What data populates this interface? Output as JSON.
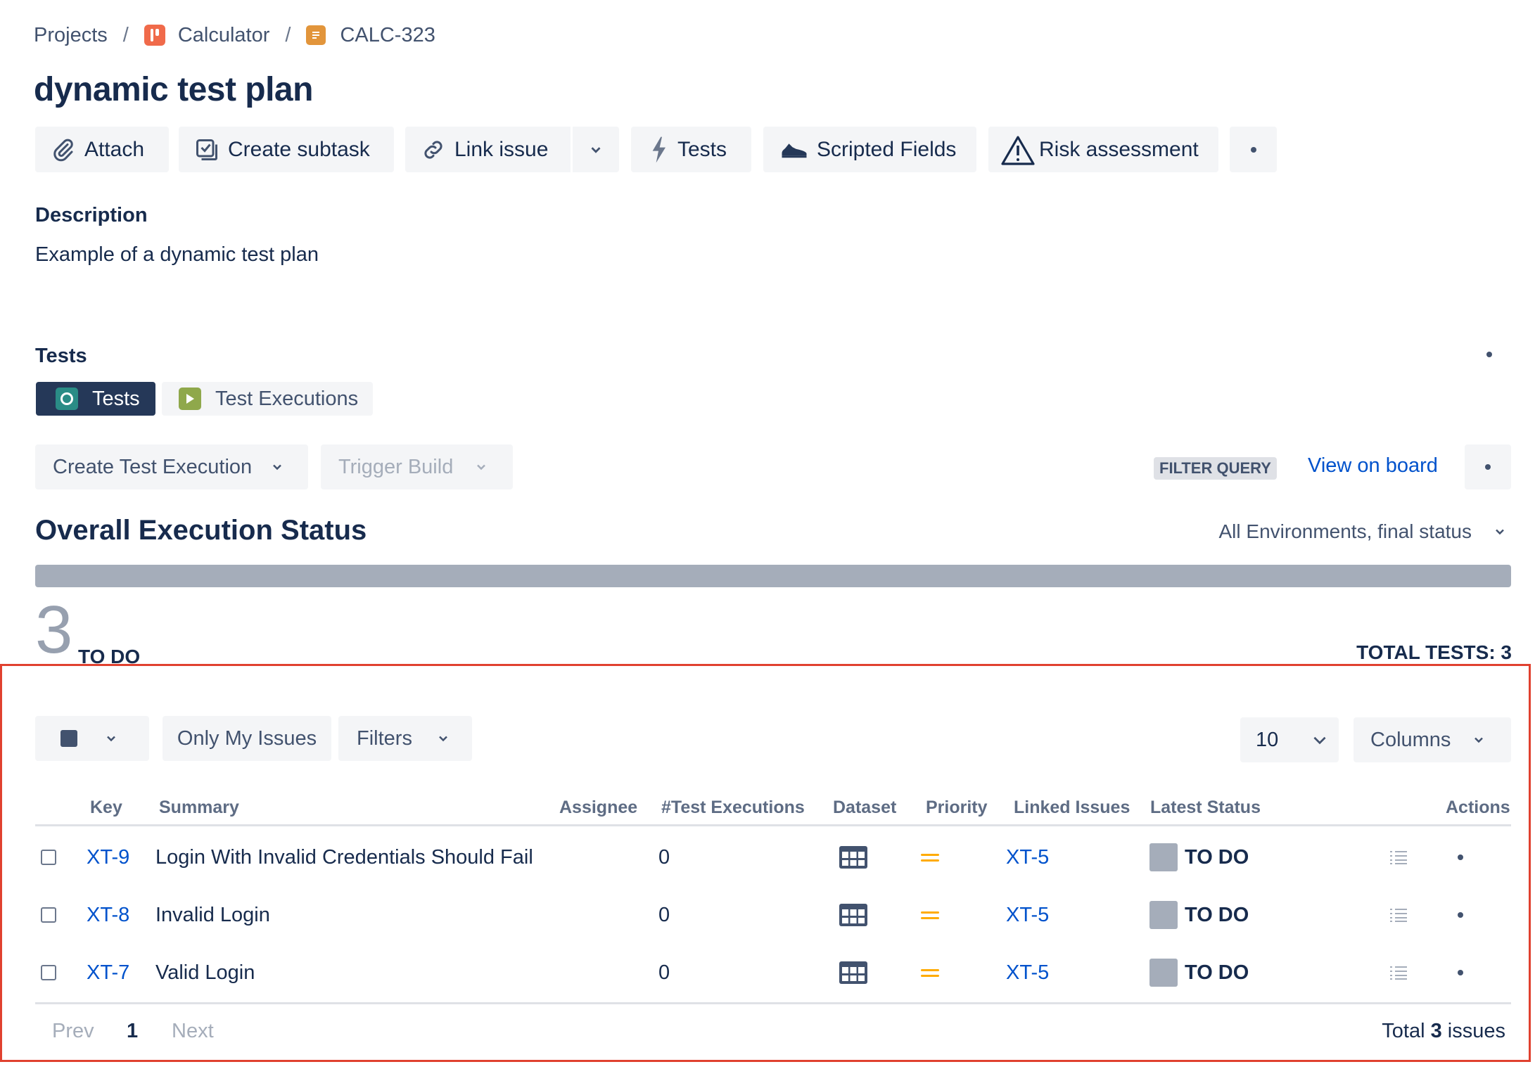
{
  "breadcrumb": {
    "projects": "Projects",
    "project": "Calculator",
    "issue_key": "CALC-323",
    "separator": "/"
  },
  "page_title": "dynamic test plan",
  "toolbar": {
    "attach": "Attach",
    "create_subtask": "Create subtask",
    "link_issue": "Link issue",
    "tests": "Tests",
    "scripted_fields": "Scripted Fields",
    "risk_assessment": "Risk assessment"
  },
  "description": {
    "heading": "Description",
    "text": "Example of a dynamic test plan"
  },
  "tests_panel": {
    "heading": "Tests",
    "tabs": [
      {
        "label": "Tests",
        "active": true
      },
      {
        "label": "Test Executions",
        "active": false
      }
    ],
    "create_test_execution": "Create Test Execution",
    "trigger_build": "Trigger Build",
    "filter_query": "FILTER QUERY",
    "view_on_board": "View on board"
  },
  "execution_status": {
    "heading": "Overall Execution Status",
    "environment_select": "All Environments, final status",
    "todo_count": "3",
    "todo_label": "TO DO",
    "total_tests": "TOTAL TESTS: 3",
    "todo_fraction": 1.0
  },
  "table_controls": {
    "only_my_issues": "Only My Issues",
    "filters": "Filters",
    "page_size": "10",
    "columns": "Columns"
  },
  "table": {
    "columns": [
      "Key",
      "Summary",
      "Assignee",
      "#Test Executions",
      "Dataset",
      "Priority",
      "Linked Issues",
      "Latest Status",
      "Actions"
    ],
    "rows": [
      {
        "key": "XT-9",
        "summary": "Login With Invalid Credentials Should Fail",
        "executions": "0",
        "linked": "XT-5",
        "status": "TO DO"
      },
      {
        "key": "XT-8",
        "summary": "Invalid Login",
        "executions": "0",
        "linked": "XT-5",
        "status": "TO DO"
      },
      {
        "key": "XT-7",
        "summary": "Valid Login",
        "executions": "0",
        "linked": "XT-5",
        "status": "TO DO"
      }
    ]
  },
  "pagination": {
    "prev": "Prev",
    "current": "1",
    "next": "Next",
    "total_prefix": "Total",
    "total_count": "3",
    "total_suffix": "issues"
  },
  "colors": {
    "link": "#0052cc",
    "todo_grey": "#a5adba",
    "priority_medium": "#ffab00",
    "tab_active": "#253858",
    "highlight_border": "#e0412f"
  },
  "icons": [
    "calculator-project-icon",
    "story-icon",
    "paperclip-icon",
    "subtask-icon",
    "link-icon",
    "lightning-icon",
    "sneaker-icon",
    "warning-icon",
    "more-icon",
    "xray-tests-icon",
    "test-execution-icon",
    "chevron-down-icon",
    "dataset-grid-icon",
    "priority-medium-icon",
    "test-steps-icon"
  ]
}
